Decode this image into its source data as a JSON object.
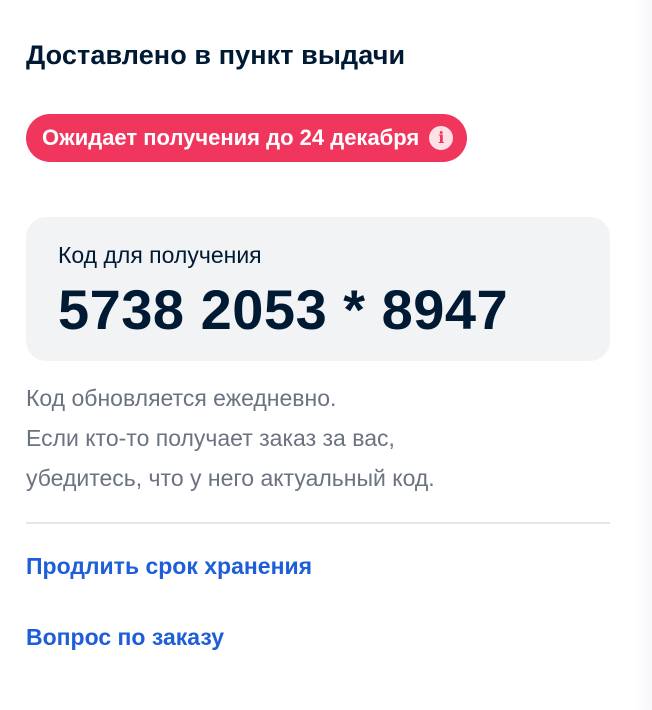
{
  "header": {
    "title": "Доставлено в пункт выдачи"
  },
  "status": {
    "text": "Ожидает получения до 24 декабря",
    "icon": "info-icon",
    "color": "#f1365d"
  },
  "pickup_code": {
    "label": "Код для получения",
    "value": "5738 2053 * 8947"
  },
  "hint": {
    "lines": [
      "Код обновляется ежедневно.",
      "Если кто-то получает заказ за вас,",
      "убедитесь, что у него актуальный код."
    ]
  },
  "actions": {
    "extend_storage": "Продлить срок хранения",
    "order_question": "Вопрос по заказу"
  },
  "colors": {
    "text_primary": "#001a34",
    "text_secondary": "#6b7280",
    "link": "#1e5ed8",
    "card_background": "#f2f3f5"
  }
}
